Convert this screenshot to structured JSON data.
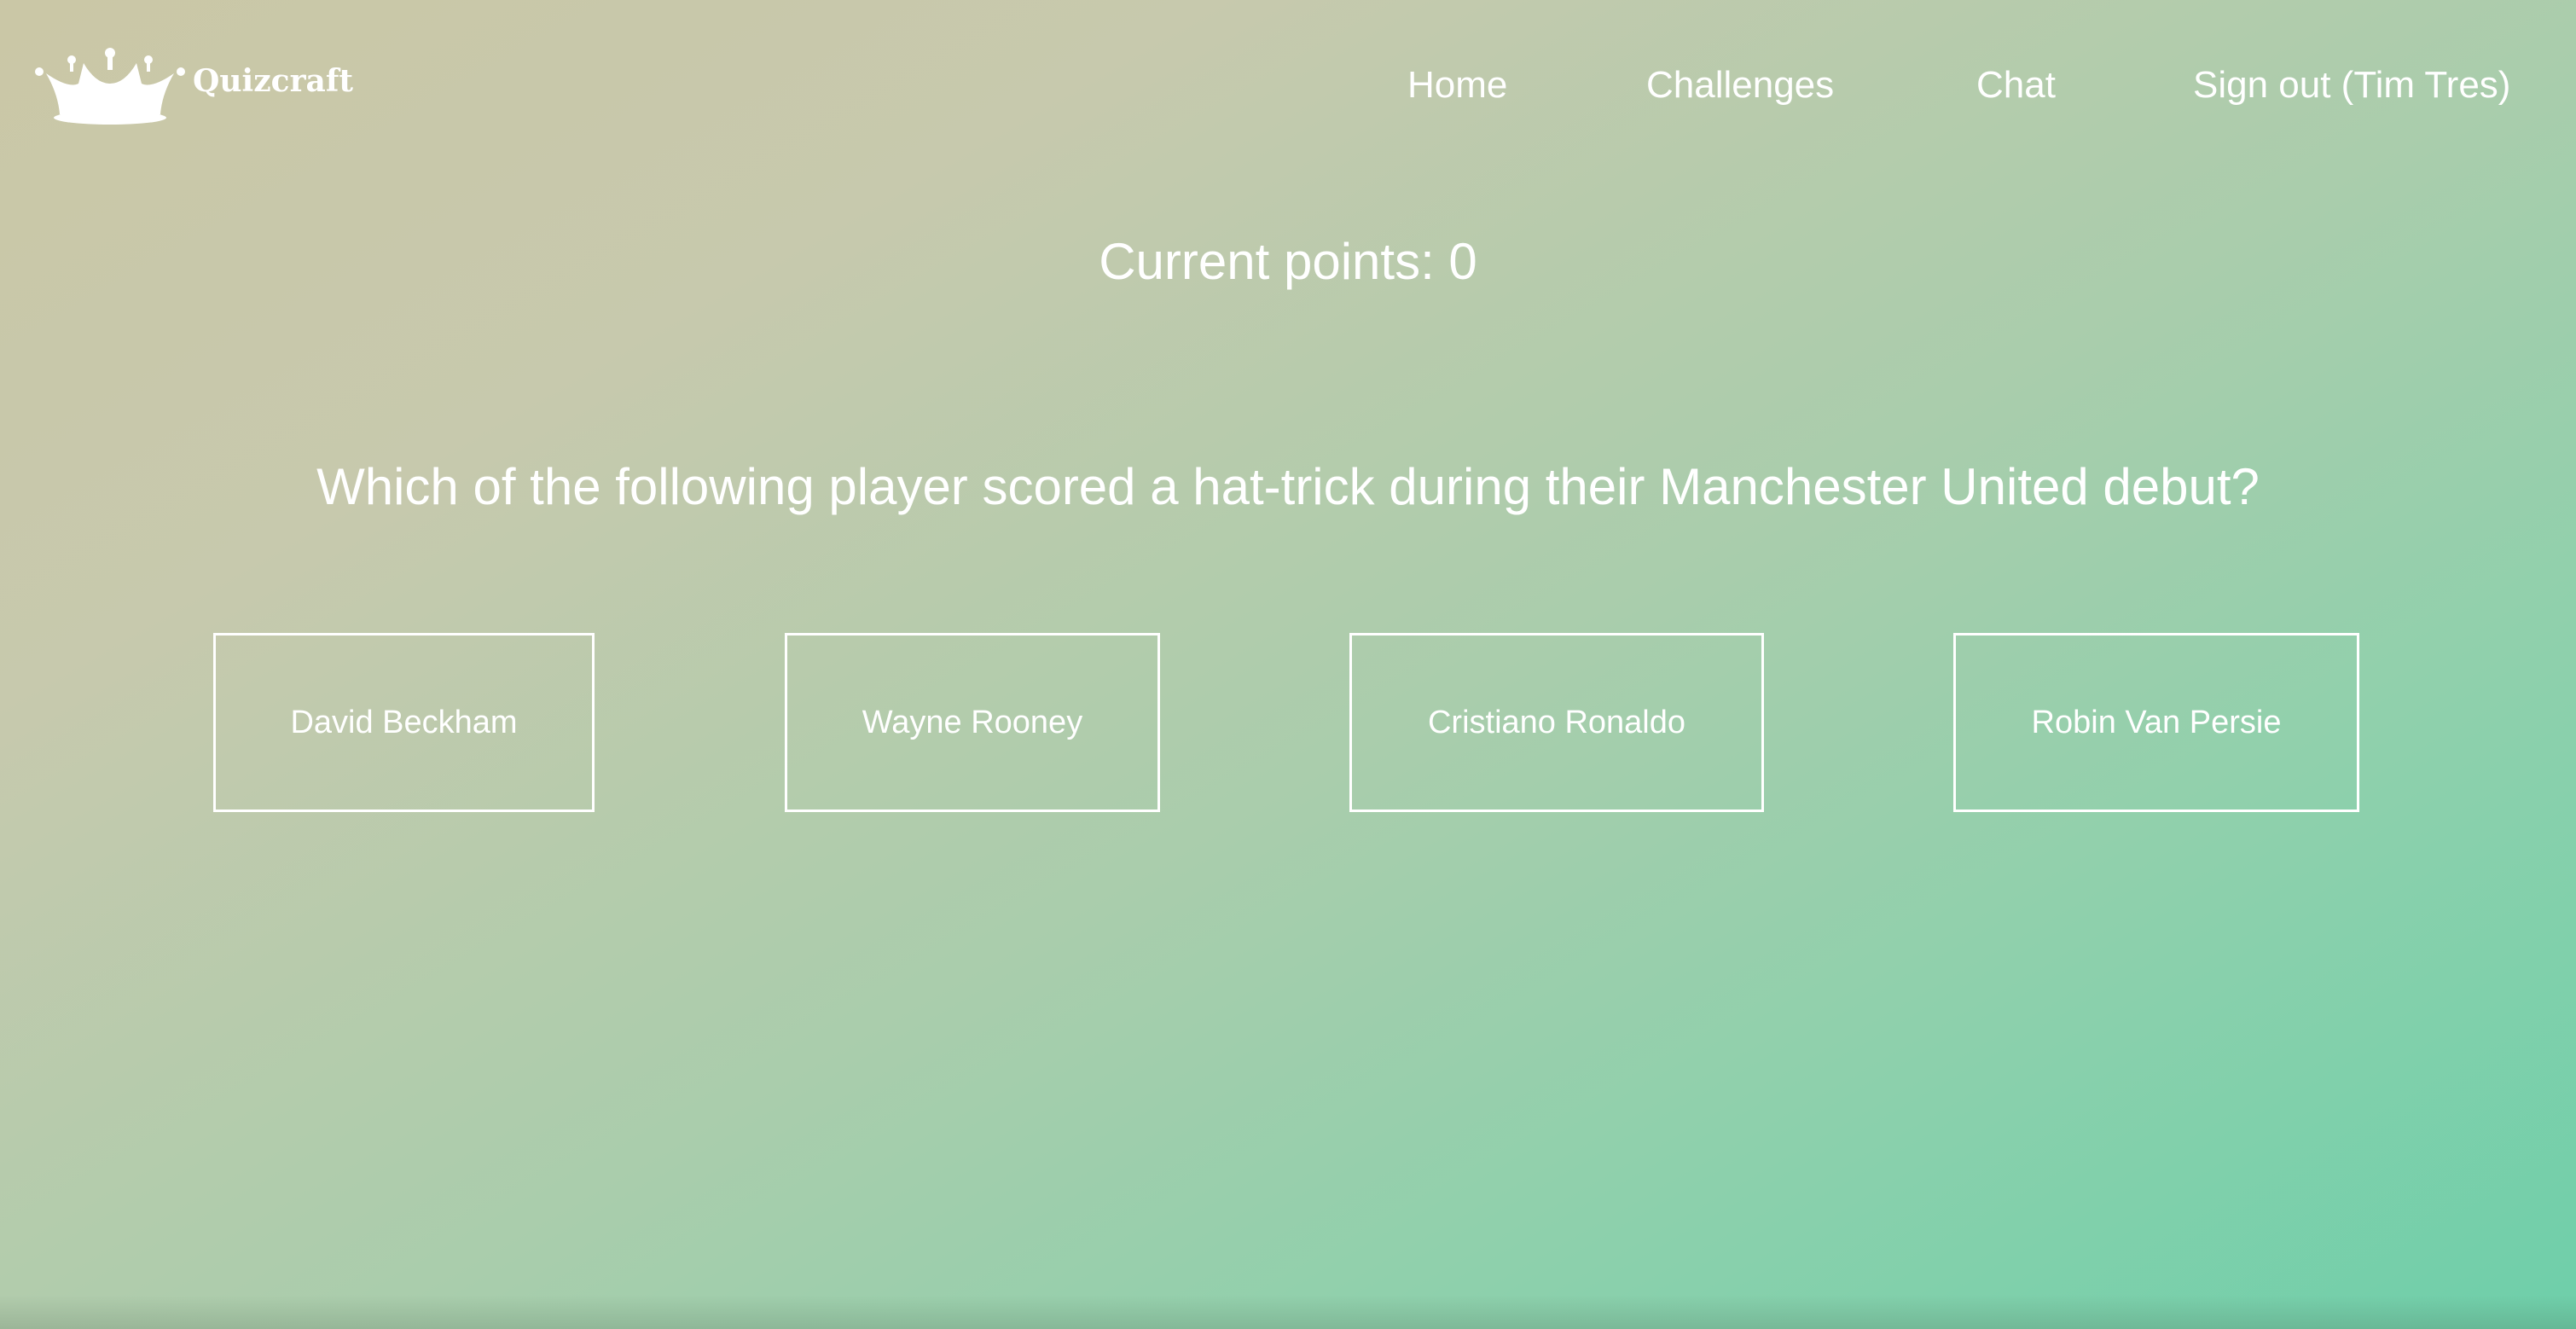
{
  "brand": {
    "name": "Quizcraft",
    "logo_icon": "crown-icon"
  },
  "nav": {
    "home": "Home",
    "challenges": "Challenges",
    "chat": "Chat",
    "signout": "Sign out (Tim Tres)"
  },
  "quiz": {
    "points_text": "Current points: 0",
    "question": "Which of the following player scored a hat-trick during their Manchester United debut?",
    "answers": [
      "David Beckham",
      "Wayne Rooney",
      "Cristiano Ronaldo",
      "Robin Van Persie"
    ]
  },
  "colors": {
    "gradient_start": "#cac7a6",
    "gradient_end": "#6ecfaa",
    "text": "#ffffff"
  }
}
